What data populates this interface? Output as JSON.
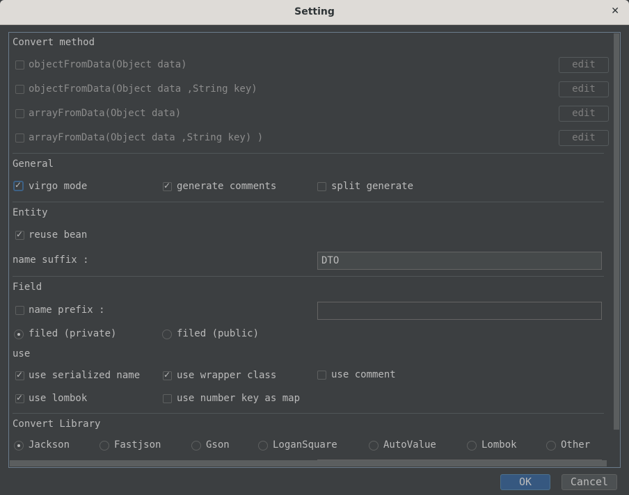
{
  "window": {
    "title": "Setting",
    "close_label": "×"
  },
  "convert_method": {
    "heading": "Convert method",
    "items": [
      {
        "label": "objectFromData(Object data)",
        "checked": false,
        "edit_label": "edit"
      },
      {
        "label": "objectFromData(Object data ,String key)",
        "checked": false,
        "edit_label": "edit"
      },
      {
        "label": "arrayFromData(Object data)",
        "checked": false,
        "edit_label": "edit"
      },
      {
        "label": "arrayFromData(Object data ,String key) )",
        "checked": false,
        "edit_label": "edit"
      }
    ]
  },
  "general": {
    "heading": "General",
    "virgo_mode": {
      "label": "virgo mode",
      "checked": true
    },
    "generate_comments": {
      "label": "generate comments",
      "checked": true
    },
    "split_generate": {
      "label": "split generate",
      "checked": false
    }
  },
  "entity": {
    "heading": "Entity",
    "reuse_bean": {
      "label": "reuse bean",
      "checked": true
    },
    "name_suffix_label": "name suffix :",
    "name_suffix_value": "DTO"
  },
  "field": {
    "heading": "Field",
    "name_prefix": {
      "label": "name prefix :",
      "checked": false,
      "value": ""
    },
    "filed_private": {
      "label": "filed (private)",
      "selected": true
    },
    "filed_public": {
      "label": "filed (public)",
      "selected": false
    }
  },
  "use": {
    "heading": "use",
    "serialized_name": {
      "label": "use serialized name",
      "checked": true
    },
    "wrapper_class": {
      "label": "use wrapper class",
      "checked": true
    },
    "comment": {
      "label": "use comment",
      "checked": false
    },
    "lombok": {
      "label": "use lombok",
      "checked": true
    },
    "number_key_as_map": {
      "label": "use number key as map",
      "checked": false
    }
  },
  "convert_library": {
    "heading": "Convert Library",
    "options": [
      {
        "label": "Jackson",
        "selected": true
      },
      {
        "label": "Fastjson",
        "selected": false
      },
      {
        "label": "Gson",
        "selected": false
      },
      {
        "label": "LoganSquare",
        "selected": false
      },
      {
        "label": "AutoValue",
        "selected": false
      },
      {
        "label": "Lombok",
        "selected": false
      },
      {
        "label": "Other",
        "selected": false
      }
    ]
  },
  "footer": {
    "ok_label": "OK",
    "cancel_label": "Cancel"
  }
}
